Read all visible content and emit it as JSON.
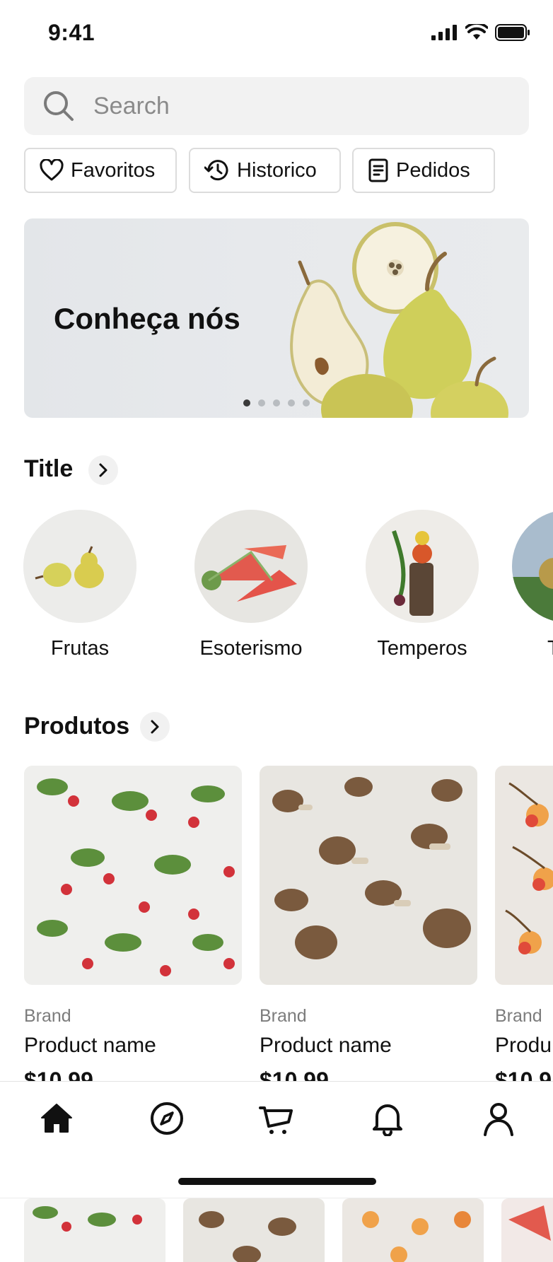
{
  "status": {
    "time": "9:41"
  },
  "search": {
    "placeholder": "Search"
  },
  "chips": [
    {
      "label": "Favoritos",
      "icon": "heart-icon"
    },
    {
      "label": "Historico",
      "icon": "history-icon"
    },
    {
      "label": "Pedidos",
      "icon": "document-icon"
    }
  ],
  "banner": {
    "title": "Conheça nós",
    "page_count": 5,
    "active_page": 1
  },
  "categories_section": {
    "title": "Title",
    "items": [
      {
        "label": "Frutas"
      },
      {
        "label": "Esoterismo"
      },
      {
        "label": "Temperos"
      },
      {
        "label": "T"
      }
    ]
  },
  "products_section": {
    "title": "Produtos",
    "items": [
      {
        "brand": "Brand",
        "name": "Product name",
        "price": "$10.99"
      },
      {
        "brand": "Brand",
        "name": "Product name",
        "price": "$10.99"
      },
      {
        "brand": "Brand",
        "name": "Produ",
        "price": "$10.9"
      }
    ]
  },
  "tabbar": {
    "items": [
      {
        "icon": "home-icon",
        "active": true
      },
      {
        "icon": "compass-icon",
        "active": false
      },
      {
        "icon": "cart-icon",
        "active": false
      },
      {
        "icon": "bell-icon",
        "active": false
      },
      {
        "icon": "profile-icon",
        "active": false
      }
    ]
  },
  "colors": {
    "text": "#111111",
    "muted": "#7c7c7c",
    "search_bg": "#f2f2f2",
    "chip_border": "#dcdcdc"
  }
}
